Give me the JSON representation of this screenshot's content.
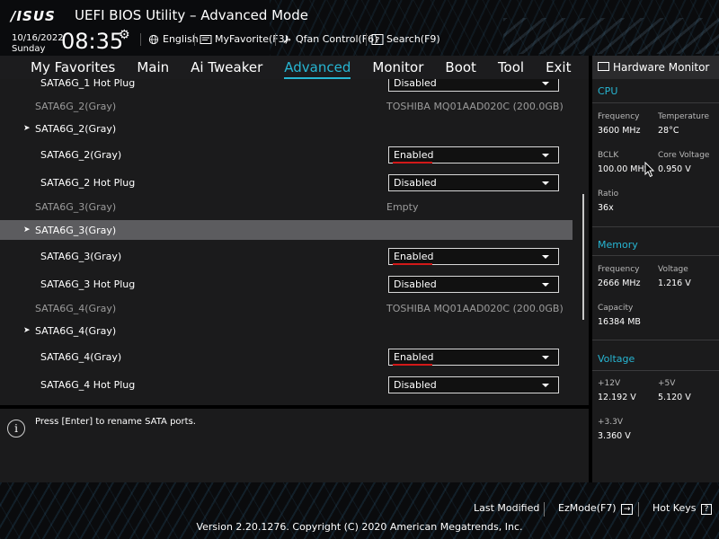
{
  "header": {
    "logo": "/ISUS",
    "title": "UEFI BIOS Utility – Advanced Mode",
    "date": "10/16/2022",
    "day": "Sunday",
    "time": "08:35",
    "buttons": {
      "language": "English",
      "myfavorite": "MyFavorite(F3)",
      "qfan": "Qfan Control(F6)",
      "search": "Search(F9)"
    }
  },
  "menu": {
    "items": [
      "My Favorites",
      "Main",
      "Ai Tweaker",
      "Advanced",
      "Monitor",
      "Boot",
      "Tool",
      "Exit"
    ],
    "active": "Advanced"
  },
  "settings": {
    "rows": [
      {
        "label": "SATA6G_1 Hot Plug",
        "control": "Disabled"
      },
      {
        "label": "SATA6G_2(Gray)",
        "value": "TOSHIBA MQ01AAD020C (200.0GB)"
      },
      {
        "label": "SATA6G_2(Gray)",
        "submenu": true
      },
      {
        "label": "SATA6G_2(Gray)",
        "control": "Enabled"
      },
      {
        "label": "SATA6G_2 Hot Plug",
        "control": "Disabled"
      },
      {
        "label": "SATA6G_3(Gray)",
        "value": "Empty"
      },
      {
        "label": "SATA6G_3(Gray)",
        "submenu": true
      },
      {
        "label": "SATA6G_3(Gray)",
        "control": "Enabled"
      },
      {
        "label": "SATA6G_3 Hot Plug",
        "control": "Disabled"
      },
      {
        "label": "SATA6G_4(Gray)",
        "value": "TOSHIBA MQ01AAD020C (200.0GB)"
      },
      {
        "label": "SATA6G_4(Gray)",
        "submenu": true
      },
      {
        "label": "SATA6G_4(Gray)",
        "control": "Enabled"
      },
      {
        "label": "SATA6G_4 Hot Plug",
        "control": "Disabled"
      }
    ]
  },
  "help": {
    "text": "Press [Enter] to rename SATA ports."
  },
  "hwmon": {
    "title": "Hardware Monitor",
    "cpu": {
      "title": "CPU",
      "frequency_label": "Frequency",
      "frequency": "3600 MHz",
      "temperature_label": "Temperature",
      "temperature": "28°C",
      "bclk_label": "BCLK",
      "bclk": "100.00 MHz",
      "core_voltage_label": "Core Voltage",
      "core_voltage": "0.950 V",
      "ratio_label": "Ratio",
      "ratio": "36x"
    },
    "memory": {
      "title": "Memory",
      "frequency_label": "Frequency",
      "frequency": "2666 MHz",
      "voltage_label": "Voltage",
      "voltage": "1.216 V",
      "capacity_label": "Capacity",
      "capacity": "16384 MB"
    },
    "voltage": {
      "title": "Voltage",
      "v12_label": "+12V",
      "v12": "12.192 V",
      "v5_label": "+5V",
      "v5": "5.120 V",
      "v33_label": "+3.3V",
      "v33": "3.360 V"
    }
  },
  "footer": {
    "last_modified": "Last Modified",
    "ezmode": "EzMode(F7)",
    "hotkeys": "Hot Keys",
    "version": "Version 2.20.1276. Copyright (C) 2020 American Megatrends, Inc."
  },
  "colors": {
    "accent": "#27b6d3",
    "highlight_row": "#5c5c5f",
    "enabled_marker": "#d21919"
  }
}
